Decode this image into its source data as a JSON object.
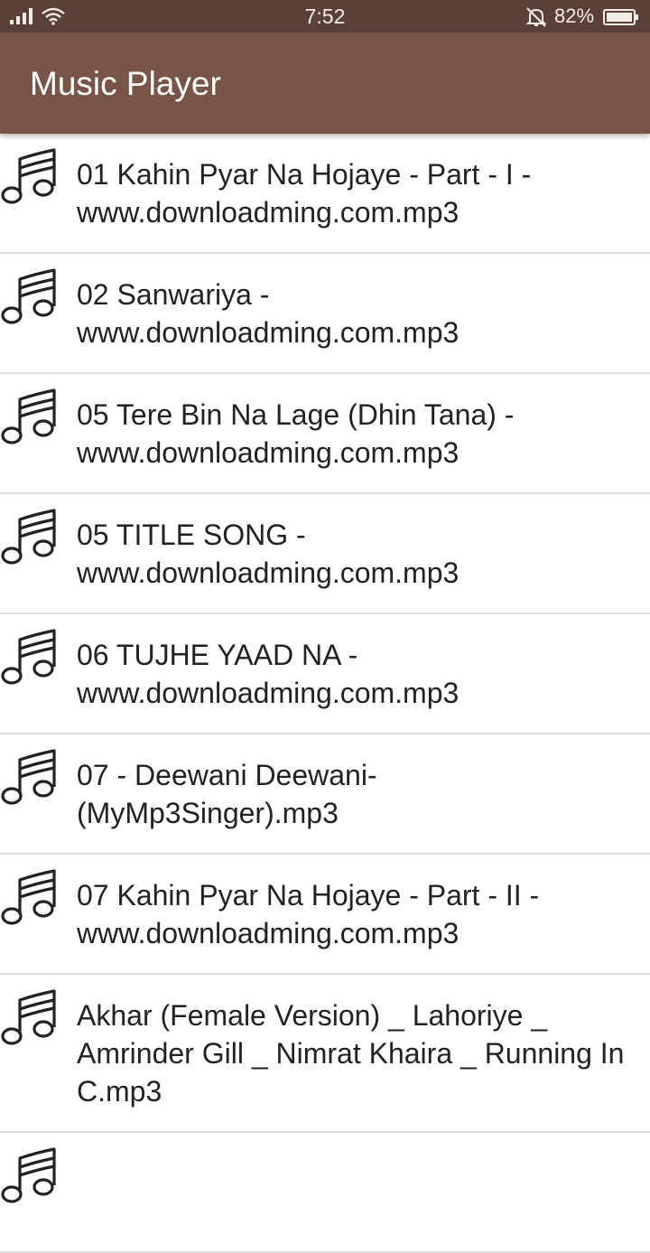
{
  "status_bar": {
    "time": "7:52",
    "battery_percent": "82%",
    "icons": [
      "signal-icon",
      "wifi-icon",
      "silent-bell-icon",
      "battery-icon"
    ]
  },
  "app_bar": {
    "title": "Music Player"
  },
  "songs": [
    "01 Kahin Pyar Na Hojaye - Part - I - www.downloadming.com.mp3",
    "02 Sanwariya - www.downloadming.com.mp3",
    "05 Tere Bin Na Lage (Dhin Tana) - www.downloadming.com.mp3",
    "05 TITLE SONG - www.downloadming.com.mp3",
    "06 TUJHE YAAD NA - www.downloadming.com.mp3",
    "07 - Deewani Deewani-(MyMp3Singer).mp3",
    "07 Kahin Pyar Na Hojaye - Part - II - www.downloadming.com.mp3",
    "Akhar (Female Version) _ Lahoriye _ Amrinder Gill _ Nimrat Khaira _ Running In C.mp3",
    ""
  ],
  "colors": {
    "status_bar_bg": "#5b4038",
    "app_bar_bg": "#785548",
    "divider": "#dcdcdc",
    "text": "#222222"
  }
}
